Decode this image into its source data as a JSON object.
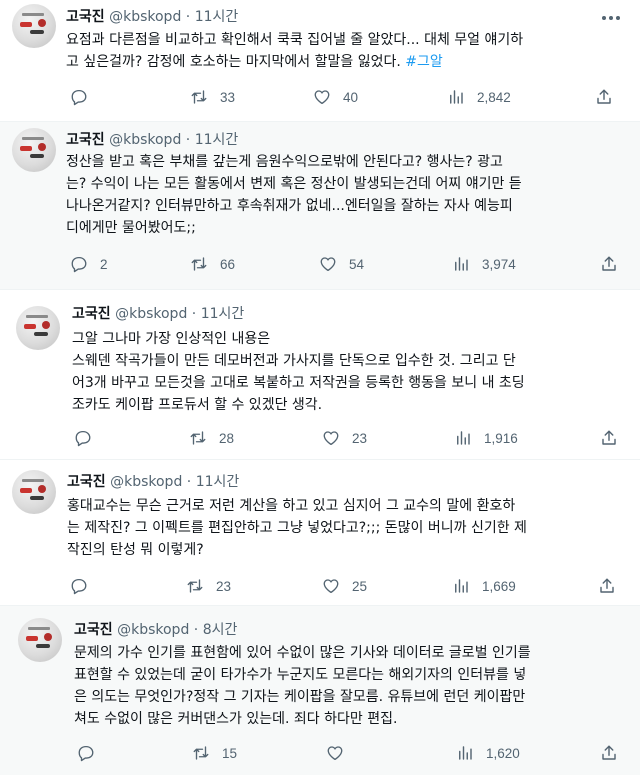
{
  "tweets": [
    {
      "name": "고국진",
      "handle": "@kbskopd",
      "dot": "·",
      "time": "11시간",
      "lines": [
        "요점과 다른점을 비교하고 확인해서 쿡쿡 집어낼 줄 알았다... 대체 무얼 얘기하",
        "고 싶은걸까? 감정에 호소하는 마지막에서 할말을 잃었다."
      ],
      "hashtag": "#그알",
      "replies": "",
      "retweets": "33",
      "likes": "40",
      "views": "2,842"
    },
    {
      "name": "고국진",
      "handle": "@kbskopd",
      "dot": "·",
      "time": "11시간",
      "lines": [
        "정산을 받고 혹은 부채를 갚는게 음원수익으로밖에 안된다고? 행사는? 광고",
        "는? 수익이 나는 모든 활동에서 변제 혹은 정산이 발생되는건데 어찌 얘기만 듣",
        "나나온거같지? 인터뷰만하고 후속취재가 없네...엔터일을 잘하는 자사 예능피",
        "디에게만 물어봤어도;;"
      ],
      "replies": "2",
      "retweets": "66",
      "likes": "54",
      "views": "3,974"
    },
    {
      "name": "고국진",
      "handle": "@kbskopd",
      "dot": "·",
      "time": "11시간",
      "lines": [
        "그알 그나마 가장 인상적인 내용은",
        "스웨덴 작곡가들이 만든 데모버전과 가사지를 단독으로 입수한 것. 그리고 단",
        "어3개 바꾸고 모든것을 고대로 복붙하고 저작권을 등록한 행동을 보니 내 초딩",
        "조카도 케이팝 프로듀서 할 수 있겠단 생각."
      ],
      "replies": "",
      "retweets": "28",
      "likes": "23",
      "views": "1,916"
    },
    {
      "name": "고국진",
      "handle": "@kbskopd",
      "dot": "·",
      "time": "11시간",
      "lines": [
        "홍대교수는 무슨 근거로 저런 계산을 하고 있고 심지어 그 교수의 말에 환호하",
        "는 제작진? 그 이펙트를 편집안하고 그냥 넣었다고?;;; 돈많이 버니까 신기한 제",
        "작진의 탄성 뭐 이렇게?"
      ],
      "replies": "",
      "retweets": "23",
      "likes": "25",
      "views": "1,669"
    },
    {
      "name": "고국진",
      "handle": "@kbskopd",
      "dot": "·",
      "time": "8시간",
      "lines": [
        "문제의 가수 인기를 표현함에 있어 수없이 많은 기사와 데이터로 글로벌 인기를",
        "표현할 수 있었는데 굳이 타가수가 누군지도 모른다는 해외기자의 인터뷰를 넣",
        "은 의도는 무엇인가?정작 그 기자는 케이팝을 잘모름. 유튜브에 런던 케이팝만",
        "쳐도 수없이 많은 커버댄스가 있는데. 죄다 하다만 편집."
      ],
      "replies": "",
      "retweets": "15",
      "likes": "",
      "views": "1,620"
    }
  ],
  "icons": {
    "reply": "reply-icon",
    "retweet": "retweet-icon",
    "like": "like-icon",
    "views": "views-icon",
    "share": "share-icon",
    "more": "more-icon"
  },
  "colors": {
    "text": "#0f1419",
    "secondary": "#536471",
    "hashtag": "#1d9bf0",
    "divider": "#eff3f4"
  }
}
